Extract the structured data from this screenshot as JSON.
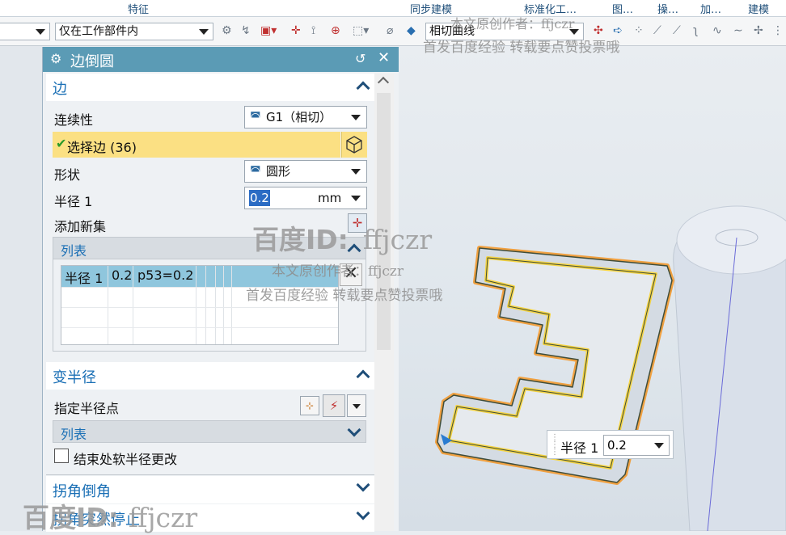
{
  "ribbon": {
    "tabs": [
      "特征",
      "同步建模",
      "标准化工…",
      "图…",
      "操…",
      "加…",
      "建模"
    ]
  },
  "toolbar": {
    "filter_scope": "仅在工作部件内",
    "curve_rule": "相切曲线"
  },
  "dialog": {
    "title": "边倒圆",
    "edge": {
      "header": "边",
      "continuity_label": "连续性",
      "continuity_value": "G1（相切）",
      "select_edge_label": "选择边 (36)",
      "shape_label": "形状",
      "shape_value": "圆形",
      "radius_label": "半径 1",
      "radius_value": "0.2",
      "radius_unit": "mm",
      "add_new_set_label": "添加新集",
      "list_header": "列表",
      "list_rows": [
        {
          "name": "半径 1",
          "value": "0.2",
          "expr": "p53=0.2"
        }
      ]
    },
    "variable_radius": {
      "header": "变半径",
      "specify_points_label": "指定半径点",
      "list_header": "列表",
      "soft_change_label": "结束处软半径更改"
    },
    "corner_setback": {
      "header": "拐角倒角"
    },
    "corner_stop": {
      "header": "拐角突然停止"
    }
  },
  "viewport": {
    "radius_tip_label": "半径 1",
    "radius_tip_value": "0.2"
  },
  "watermark": {
    "logo": "百度ID:",
    "id": "ffjczr",
    "line1": "本文原创作者：ffjczr",
    "line2": "首发百度经验 转载要点赞投票哦"
  },
  "colors": {
    "title_bar": "#5b9bb5",
    "selected_row": "#fbe083",
    "list_selection": "#8fc6dd",
    "section_header_text": "#1a6fb5",
    "model_edge_highlight": "#f0a040"
  }
}
